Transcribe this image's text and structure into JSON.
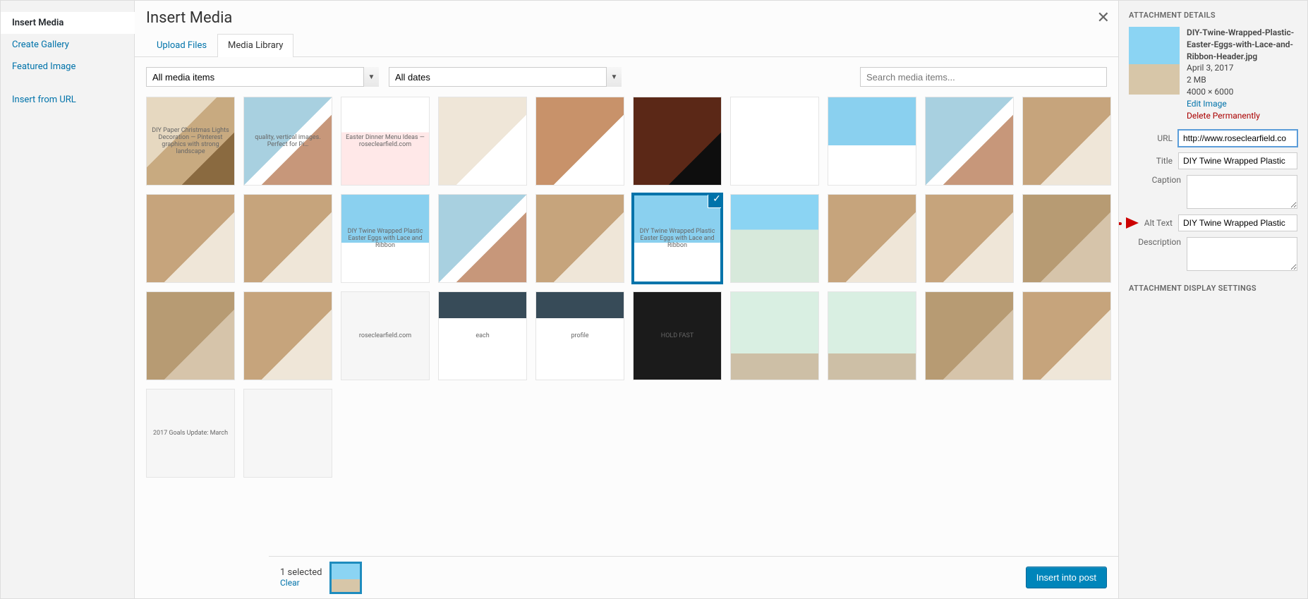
{
  "sidebar": {
    "items": [
      {
        "label": "Insert Media",
        "active": true
      },
      {
        "label": "Create Gallery",
        "active": false
      },
      {
        "label": "Featured Image",
        "active": false
      },
      {
        "label": "Insert from URL",
        "active": false
      }
    ]
  },
  "header": {
    "title": "Insert Media"
  },
  "tabs": {
    "upload": "Upload Files",
    "library": "Media Library",
    "active": "library"
  },
  "filters": {
    "type": "All media items",
    "date": "All dates"
  },
  "search": {
    "placeholder": "Search media items..."
  },
  "grid": {
    "items": [
      {
        "bg": "bg-a",
        "hint": "DIY Paper Christmas Lights Decoration — Pinterest graphics with strong landscape"
      },
      {
        "bg": "bg-b",
        "hint": "quality, vertical images. Perfect for Pi…"
      },
      {
        "bg": "bg-c",
        "hint": "Easter Dinner Menu Ideas — roseclearfield.com"
      },
      {
        "bg": "bg-d",
        "hint": ""
      },
      {
        "bg": "bg-e",
        "hint": ""
      },
      {
        "bg": "bg-f",
        "hint": ""
      },
      {
        "bg": "bg-g",
        "hint": ""
      },
      {
        "bg": "bg-h",
        "hint": ""
      },
      {
        "bg": "bg-b",
        "hint": ""
      },
      {
        "bg": "bg-i",
        "hint": ""
      },
      {
        "bg": "bg-i",
        "hint": ""
      },
      {
        "bg": "bg-i",
        "hint": ""
      },
      {
        "bg": "bg-h",
        "hint": "DIY Twine Wrapped Plastic Easter Eggs with Lace and Ribbon"
      },
      {
        "bg": "bg-b",
        "hint": ""
      },
      {
        "bg": "bg-i",
        "hint": ""
      },
      {
        "bg": "bg-h",
        "hint": "DIY Twine Wrapped Plastic Easter Eggs with Lace and Ribbon",
        "selected": true
      },
      {
        "bg": "bg-k",
        "hint": ""
      },
      {
        "bg": "bg-i",
        "hint": ""
      },
      {
        "bg": "bg-i",
        "hint": ""
      },
      {
        "bg": "bg-n",
        "hint": ""
      },
      {
        "bg": "bg-n",
        "hint": ""
      },
      {
        "bg": "bg-i",
        "hint": ""
      },
      {
        "bg": "bg-j",
        "hint": "roseclearfield.com"
      },
      {
        "bg": "bg-l",
        "hint": "each"
      },
      {
        "bg": "bg-l",
        "hint": "profile"
      },
      {
        "bg": "bg-o",
        "hint": "HOLD FAST"
      },
      {
        "bg": "bg-m",
        "hint": ""
      },
      {
        "bg": "bg-m",
        "hint": ""
      },
      {
        "bg": "bg-n",
        "hint": ""
      },
      {
        "bg": "bg-i",
        "hint": ""
      },
      {
        "bg": "bg-j",
        "hint": "2017 Goals Update: March"
      },
      {
        "bg": "bg-j",
        "hint": ""
      }
    ]
  },
  "details": {
    "heading": "ATTACHMENT DETAILS",
    "filename": "DIY-Twine-Wrapped-Plastic-Easter-Eggs-with-Lace-and-Ribbon-Header.jpg",
    "date": "April 3, 2017",
    "filesize": "2 MB",
    "dimensions": "4000 × 6000",
    "edit_label": "Edit Image",
    "delete_label": "Delete Permanently",
    "fields": {
      "url_label": "URL",
      "url_value": "http://www.roseclearfield.co",
      "title_label": "Title",
      "title_value": "DIY Twine Wrapped Plastic",
      "caption_label": "Caption",
      "caption_value": "",
      "alt_label": "Alt Text",
      "alt_value": "DIY Twine Wrapped Plastic",
      "desc_label": "Description",
      "desc_value": ""
    },
    "display_heading": "ATTACHMENT DISPLAY SETTINGS"
  },
  "footer": {
    "selected_text": "1 selected",
    "clear_label": "Clear",
    "insert_label": "Insert into post"
  }
}
